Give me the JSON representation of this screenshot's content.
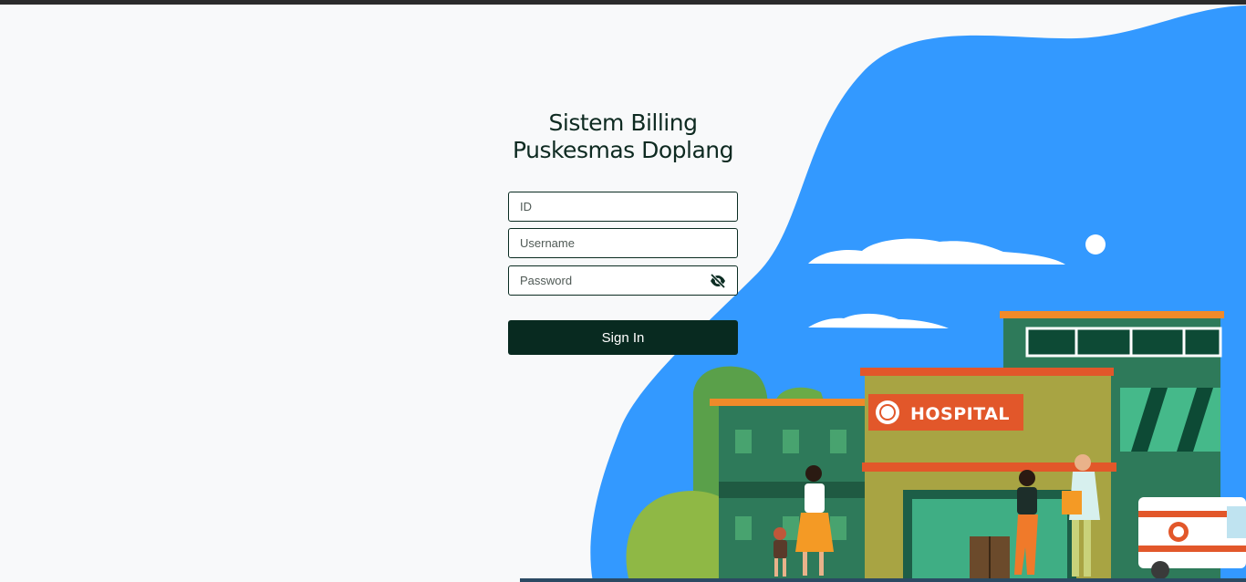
{
  "login": {
    "title_line1": "Sistem Billing",
    "title_line2": "Puskesmas Doplang",
    "id_placeholder": "ID",
    "username_placeholder": "Username",
    "password_placeholder": "Password",
    "signin_label": "Sign In",
    "password_toggle_icon": "eye-slash-icon"
  },
  "illustration": {
    "sign_text": "HOSPITAL"
  },
  "colors": {
    "background": "#f8f9fa",
    "blob": "#3399ff",
    "button": "#082a20",
    "sign": "#e2572a",
    "building_green": "#2e7a5a"
  }
}
